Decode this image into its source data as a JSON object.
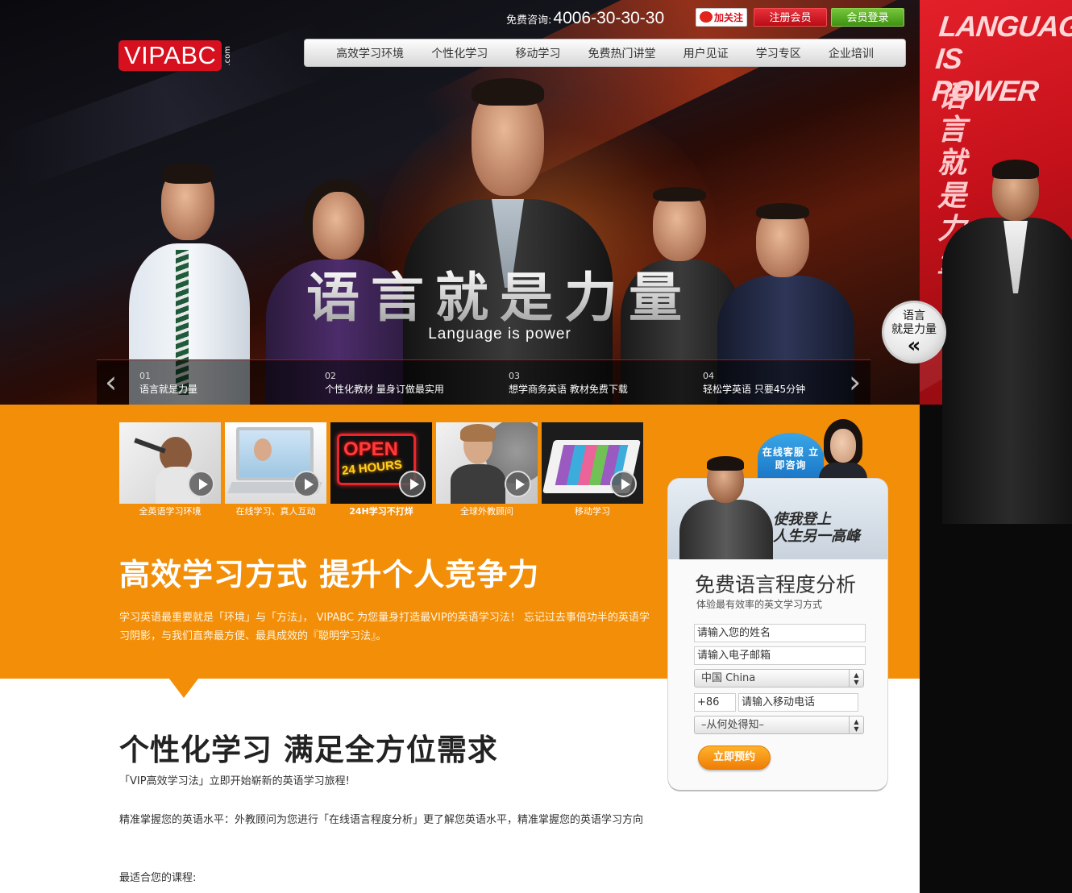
{
  "header": {
    "logo": "VIPABC",
    "logo_suffix": ".com",
    "phone_label": "免费咨询:",
    "phone_number": "4006-30-30-30",
    "follow_label": "加关注",
    "register_label": "注册会员",
    "login_label": "会员登录"
  },
  "nav": [
    "高效学习环境",
    "个性化学习",
    "移动学习",
    "免费热门讲堂",
    "用户见证",
    "学习专区",
    "企业培训"
  ],
  "hero": {
    "headline_cn": "语言就是力量",
    "headline_en": "Language is power"
  },
  "slider": [
    {
      "num": "01",
      "text": "语言就是力量"
    },
    {
      "num": "02",
      "text": "个性化教材 量身订做最实用"
    },
    {
      "num": "03",
      "text": "想学商务英语 教材免费下载"
    },
    {
      "num": "04",
      "text": "轻松学英语 只要45分钟"
    }
  ],
  "thumbs": [
    {
      "caption": "全英语学习环境"
    },
    {
      "caption": "在线学习、真人互动"
    },
    {
      "caption": "24H学习不打烊",
      "sign_top": "OPEN",
      "sign_bottom": "24 HOURS"
    },
    {
      "caption": "全球外教顾问"
    },
    {
      "caption": "移动学习"
    }
  ],
  "orange": {
    "title": "高效学习方式  提升个人竞争力",
    "text": "学习英语最重要就是「环境」与「方法」， VIPABC 为您量身打造最VIP的英语学习法！ 忘记过去事倍功半的英语学习阴影，与我们直奔最方便、最具成效的『聪明学习法』。"
  },
  "white": {
    "title": "个性化学习  满足全方位需求",
    "p1": "「VIP高效学习法」立即开始崭新的英语学习旅程!",
    "p2": "精准掌握您的英语水平：外教顾问为您进行「在线语言程度分析」更了解您英语水平，精准掌握您的英语学习方向",
    "p3": "最适合您的课程:"
  },
  "sidebar": {
    "title_en": "LANGUAGE IS POWER",
    "title_cn": "语言就是力量",
    "toggle_line1": "语言",
    "toggle_line2": "就是力量"
  },
  "form": {
    "cs_badge": "在线客服 立即咨询",
    "slogan_line1": "使我登上",
    "slogan_line2": "人生另一高峰",
    "title": "免费语言程度分析",
    "subtitle": "体验最有效率的英文学习方式",
    "name_placeholder": "请输入您的姓名",
    "email_placeholder": "请输入电子邮箱",
    "country": "中国 China",
    "phone_prefix": "+86",
    "phone_placeholder": "请输入移动电话",
    "source": "–从何处得知–",
    "submit_label": "立即预约"
  },
  "colors": {
    "brand_red": "#d6101e",
    "orange": "#f38e08",
    "login_green": "#4fa81f"
  }
}
